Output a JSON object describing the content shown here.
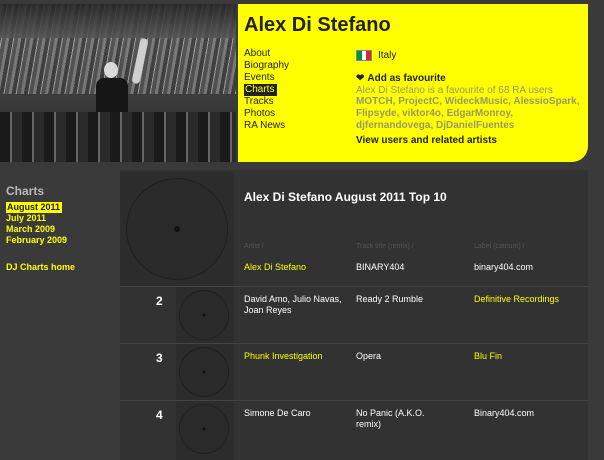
{
  "artist": {
    "name": "Alex Di Stefano"
  },
  "nav": {
    "items": [
      "About",
      "Biography",
      "Events",
      "Charts",
      "Tracks",
      "Photos",
      "RA News"
    ],
    "active": "Charts"
  },
  "info": {
    "country": "Italy",
    "add_fav": "Add as favourite",
    "fav_text": "Alex Di Stefano is a favourite of 68 RA users",
    "users": "MOTCH, ProjectC, WideckMusic, AlessioSpark, Flipsyde, viktor4o, EdgarMonroy, djfernandovega, DjDanielFuentes",
    "related": "View users and related artists"
  },
  "sidebar": {
    "title": "Charts",
    "links": [
      "August 2011",
      "July 2011",
      "March 2009",
      "February 2009"
    ],
    "home": "DJ Charts home"
  },
  "chart": {
    "title": "Alex Di Stefano August 2011 Top 10",
    "headers": {
      "artist": "Artist /",
      "track": "Track title (remix) /",
      "label": "Label (catnum) /"
    },
    "rows": [
      {
        "num": "",
        "artist": "Alex Di Stefano",
        "track": "BINARY404",
        "label": "binary404.com",
        "artist_color": "yellow",
        "label_color": "white"
      },
      {
        "num": "2",
        "artist": "David Amo, Julio Navas, Joan Reyes",
        "track": "Ready 2 Rumble",
        "label": "Definitive Recordings",
        "artist_color": "white",
        "label_color": "yellow"
      },
      {
        "num": "3",
        "artist": "Phunk Investigation",
        "track": "Opera",
        "label": "Blu Fin",
        "artist_color": "yellow",
        "label_color": "yellow"
      },
      {
        "num": "4",
        "artist": "Simone De Caro",
        "track": "No Panic (A.K.O. remix)",
        "label": "Binary404.com",
        "artist_color": "white",
        "label_color": "white"
      }
    ]
  },
  "flag_colors": [
    "#009246",
    "#ffffff",
    "#ce2b37"
  ],
  "accent": "#ffff00"
}
